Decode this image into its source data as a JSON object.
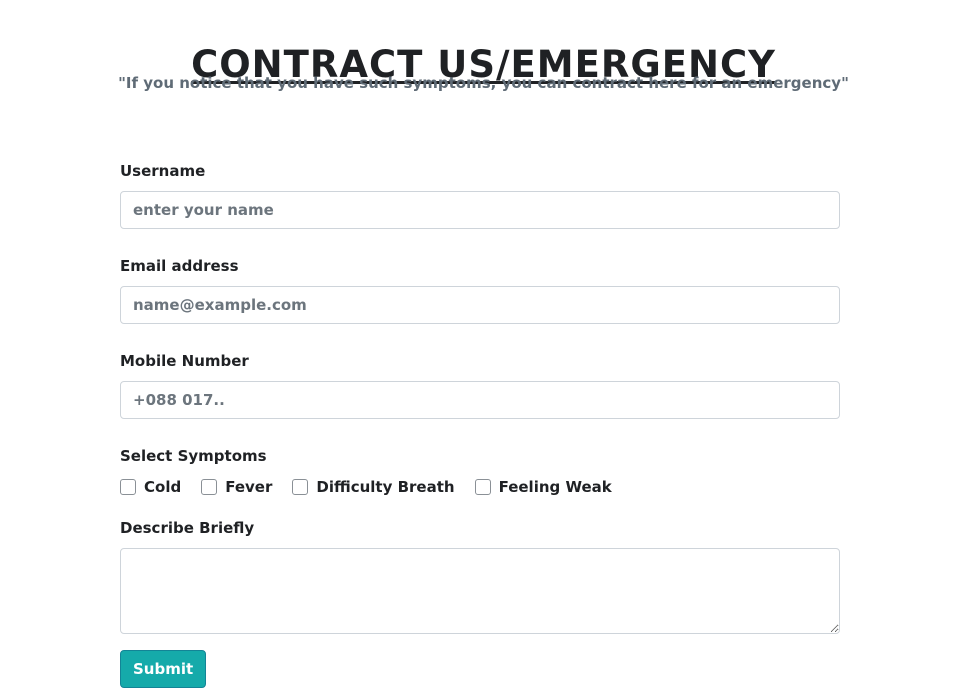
{
  "header": {
    "title": "CONTRACT US/EMERGENCY",
    "subtitle": "\"If you notice that you have such symptoms, you can contract here for an emergency\""
  },
  "form": {
    "username": {
      "label": "Username",
      "placeholder": "enter your name",
      "value": ""
    },
    "email": {
      "label": "Email address",
      "placeholder": "name@example.com",
      "value": ""
    },
    "mobile": {
      "label": "Mobile Number",
      "placeholder": "+088 017..",
      "value": ""
    },
    "symptoms": {
      "label": "Select Symptoms",
      "options": [
        {
          "label": "Cold",
          "checked": false
        },
        {
          "label": "Fever",
          "checked": false
        },
        {
          "label": "Difficulty Breath",
          "checked": false
        },
        {
          "label": "Feeling Weak",
          "checked": false
        }
      ]
    },
    "description": {
      "label": "Describe Briefly",
      "value": ""
    },
    "submit_label": "Submit"
  },
  "colors": {
    "accent": "#15aaaa",
    "text": "#1f2124",
    "muted": "#5f6b76",
    "border": "#ced4da"
  }
}
